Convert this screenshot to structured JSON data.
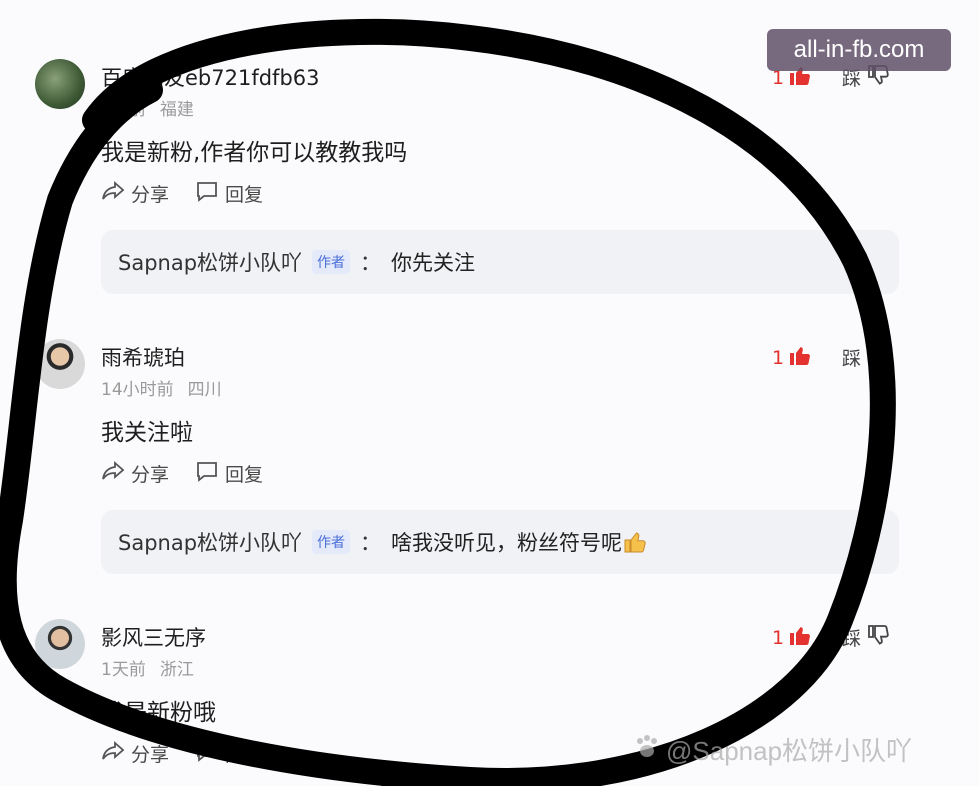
{
  "comments": [
    {
      "username": "百度网友eb721fdfb63",
      "time": "1天前",
      "location": "福建",
      "text": "我是新粉,作者你可以教教我吗",
      "share_label": "分享",
      "reply_label": "回复",
      "likes": "1",
      "dislike_label": "踩",
      "author_reply": {
        "name": "Sapnap松饼小队吖",
        "tag": "作者",
        "colon": "：",
        "text": "你先关注"
      }
    },
    {
      "username": "雨希琥珀",
      "time": "14小时前",
      "location": "四川",
      "text": "我关注啦",
      "share_label": "分享",
      "reply_label": "回复",
      "likes": "1",
      "dislike_label": "踩",
      "author_reply": {
        "name": "Sapnap松饼小队吖",
        "tag": "作者",
        "colon": "：",
        "text": "啥我没听见，粉丝符号呢",
        "emoji": "thumbs-up"
      }
    },
    {
      "username": "影风三无序",
      "time": "1天前",
      "location": "浙江",
      "text": "我是新粉哦",
      "share_label": "分享",
      "reply_label": "回复",
      "likes": "1",
      "dislike_label": "踩"
    }
  ],
  "watermark_top": "all-in-fb.com",
  "watermark_bottom": "@Sapnap松饼小队吖",
  "colors": {
    "like": "#e3322f",
    "tag": "#4a6fd8",
    "reply_bg": "#f1f2f5"
  }
}
